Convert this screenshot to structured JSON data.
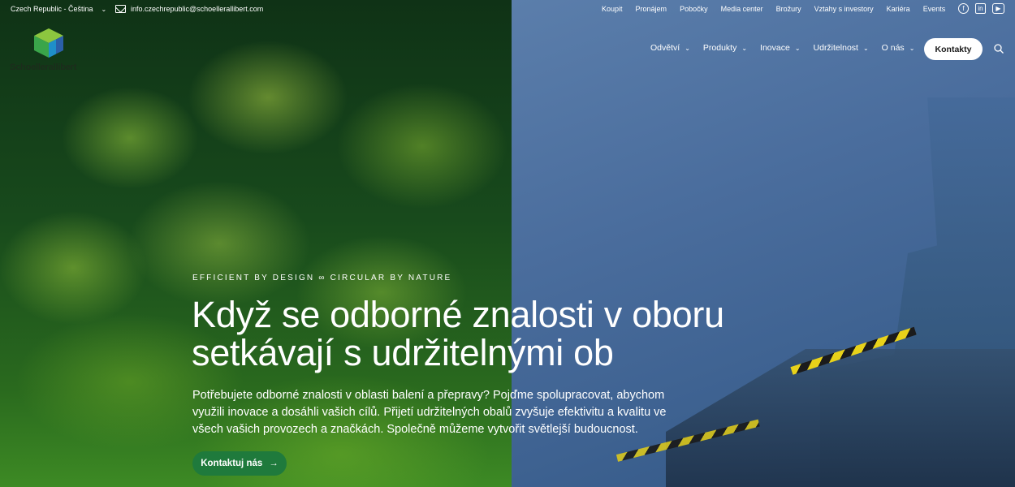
{
  "topbar": {
    "language": "Czech Republic - Čeština",
    "email": "info.czechrepublic@schoellerallibert.com",
    "links": [
      "Koupit",
      "Pronájem",
      "Pobočky",
      "Media center",
      "Brožury",
      "Vztahy s investory",
      "Kariéra",
      "Events"
    ],
    "social": [
      "facebook-icon",
      "linkedin-icon",
      "youtube-icon"
    ]
  },
  "logo": {
    "text": "Schoellerallibert",
    "colors": [
      "#3aa54a",
      "#8cc63f",
      "#2b5fa8",
      "#1f8fc9"
    ]
  },
  "nav": {
    "items": [
      "Odvětví",
      "Produkty",
      "Inovace",
      "Udržitelnost",
      "O nás"
    ],
    "contact_label": "Kontakty"
  },
  "hero": {
    "eyebrow": "EFFICIENT BY DESIGN ∞ CIRCULAR BY NATURE",
    "headline": "Když se odborné znalosti v oboru setkávají s udržitelnými ob",
    "lead": "Potřebujete odborné znalosti v oblasti balení a přepravy? Pojďme spolupracovat, abychom využili inovace a dosáhli vašich cílů. Přijetí udržitelných obalů zvyšuje efektivitu a kvalitu ve všech vašich provozech a značkách. Společně můžeme vytvořit světlejší budoucnost.",
    "cta_label": "Kontaktuj nás",
    "cta_color": "#1f7a3c"
  }
}
